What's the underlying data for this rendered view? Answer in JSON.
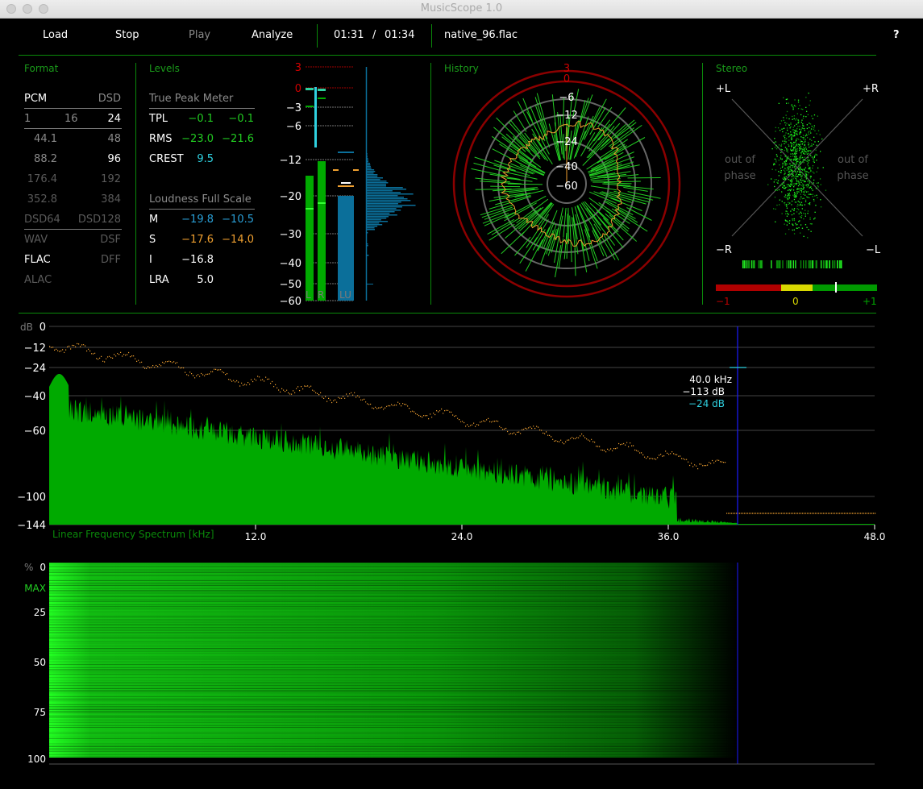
{
  "window": {
    "title": "MusicScope 1.0"
  },
  "toolbar": {
    "load": "Load",
    "stop": "Stop",
    "play": "Play",
    "analyze": "Analyze",
    "time_current": "01:31",
    "time_sep": "/",
    "time_total": "01:34",
    "filename": "native_96.flac",
    "help": "?"
  },
  "format": {
    "title": "Format",
    "rows": [
      {
        "left": "PCM",
        "right": "DSD"
      },
      {
        "left": "1",
        "mid": "16",
        "right": "24"
      },
      {
        "left": "44.1",
        "right": "48"
      },
      {
        "left": "88.2",
        "right": "96"
      },
      {
        "left": "176.4",
        "right": "192"
      },
      {
        "left": "352.8",
        "right": "384"
      },
      {
        "left": "DSD64",
        "right": "DSD128"
      },
      {
        "left": "WAV",
        "right": "DSF"
      },
      {
        "left": "FLAC",
        "right": "DFF"
      },
      {
        "left": "ALAC",
        "right": ""
      }
    ]
  },
  "levels": {
    "title": "Levels",
    "tpm_title": "True Peak Meter",
    "tpl": {
      "label": "TPL",
      "l": "−0.1",
      "r": "−0.1"
    },
    "rms": {
      "label": "RMS",
      "l": "−23.0",
      "r": "−21.6"
    },
    "crest": {
      "label": "CREST",
      "v": "9.5"
    },
    "lfs_title": "Loudness Full Scale",
    "m": {
      "label": "M",
      "a": "−19.8",
      "b": "−10.5"
    },
    "s": {
      "label": "S",
      "a": "−17.6",
      "b": "−14.0"
    },
    "i": {
      "label": "I",
      "v": "−16.8"
    },
    "lra": {
      "label": "LRA",
      "v": "5.0"
    },
    "scale": [
      "3",
      "0",
      "−3",
      "−6",
      "−12",
      "−20",
      "−30",
      "−40",
      "−50",
      "−60"
    ],
    "bar_labels": {
      "l": "L",
      "r": "R",
      "lu": "LU"
    },
    "meter_values_db": {
      "L_rms": -14.5,
      "R_rms": -12.3,
      "LU": -19.8,
      "L_peak": -0.1,
      "R_peak": -0.1
    }
  },
  "history": {
    "title": "History",
    "rings": [
      "3",
      "0",
      "−6",
      "−12",
      "−24",
      "−40",
      "−60"
    ]
  },
  "stereo": {
    "title": "Stereo",
    "corners": {
      "tl": "+L",
      "tr": "+R",
      "bl": "−R",
      "br": "−L"
    },
    "out_of_phase": "out of phase",
    "corr_labels": {
      "neg": "−1",
      "zero": "0",
      "pos": "+1"
    },
    "correlation": 0.6
  },
  "spectrum": {
    "unit": "dB",
    "y_ticks": [
      "0",
      "−12",
      "−24",
      "−40",
      "−60",
      "−100",
      "−144"
    ],
    "x_ticks": [
      "12.0",
      "24.0",
      "36.0",
      "48.0"
    ],
    "title": "Linear Frequency Spectrum [kHz]",
    "cursor": {
      "freq": "40.0 kHz",
      "level": "−113 dB",
      "peak": "−24 dB"
    }
  },
  "spectrogram": {
    "unit": "%",
    "max_label": "MAX",
    "y_ticks": [
      "0",
      "25",
      "50",
      "75",
      "100"
    ]
  },
  "colors": {
    "accent": "#0a8a0a",
    "green": "#00aa00",
    "orange": "#f0a030",
    "cyan": "#2fd1e0",
    "blue_meter": "#0b6f9a",
    "red": "#8b0000",
    "cursor": "#1a1aff"
  }
}
